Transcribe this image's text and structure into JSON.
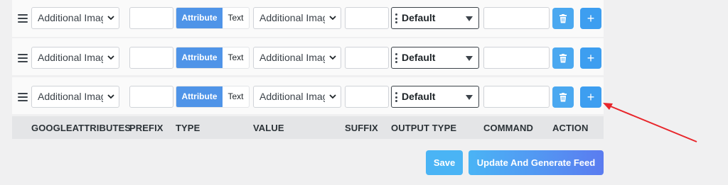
{
  "rows": [
    {
      "attribute": "Additional Imag",
      "type_attr": "Attribute",
      "type_text": "Text",
      "value": "Additional Imag",
      "output": "Default"
    },
    {
      "attribute": "Additional Imag",
      "type_attr": "Attribute",
      "type_text": "Text",
      "value": "Additional Imag",
      "output": "Default"
    },
    {
      "attribute": "Additional Imag",
      "type_attr": "Attribute",
      "type_text": "Text",
      "value": "Additional Imag",
      "output": "Default"
    }
  ],
  "headers": {
    "googleattributes": "GOOGLEATTRIBUTES",
    "prefix": "PREFIX",
    "type": "TYPE",
    "value": "VALUE",
    "suffix": "SUFFIX",
    "output_type": "OUTPUT TYPE",
    "command": "COMMAND",
    "action": "ACTION"
  },
  "buttons": {
    "save": "Save",
    "update": "Update And Generate Feed",
    "add": "+"
  },
  "colors": {
    "accent": "#4f94e8",
    "action_button": "#3d9ef0",
    "annotation_arrow": "#e8262b"
  },
  "icons": [
    "drag-handle-icon",
    "chevron-down-icon",
    "trash-icon",
    "plus-icon",
    "annotation-arrow"
  ]
}
